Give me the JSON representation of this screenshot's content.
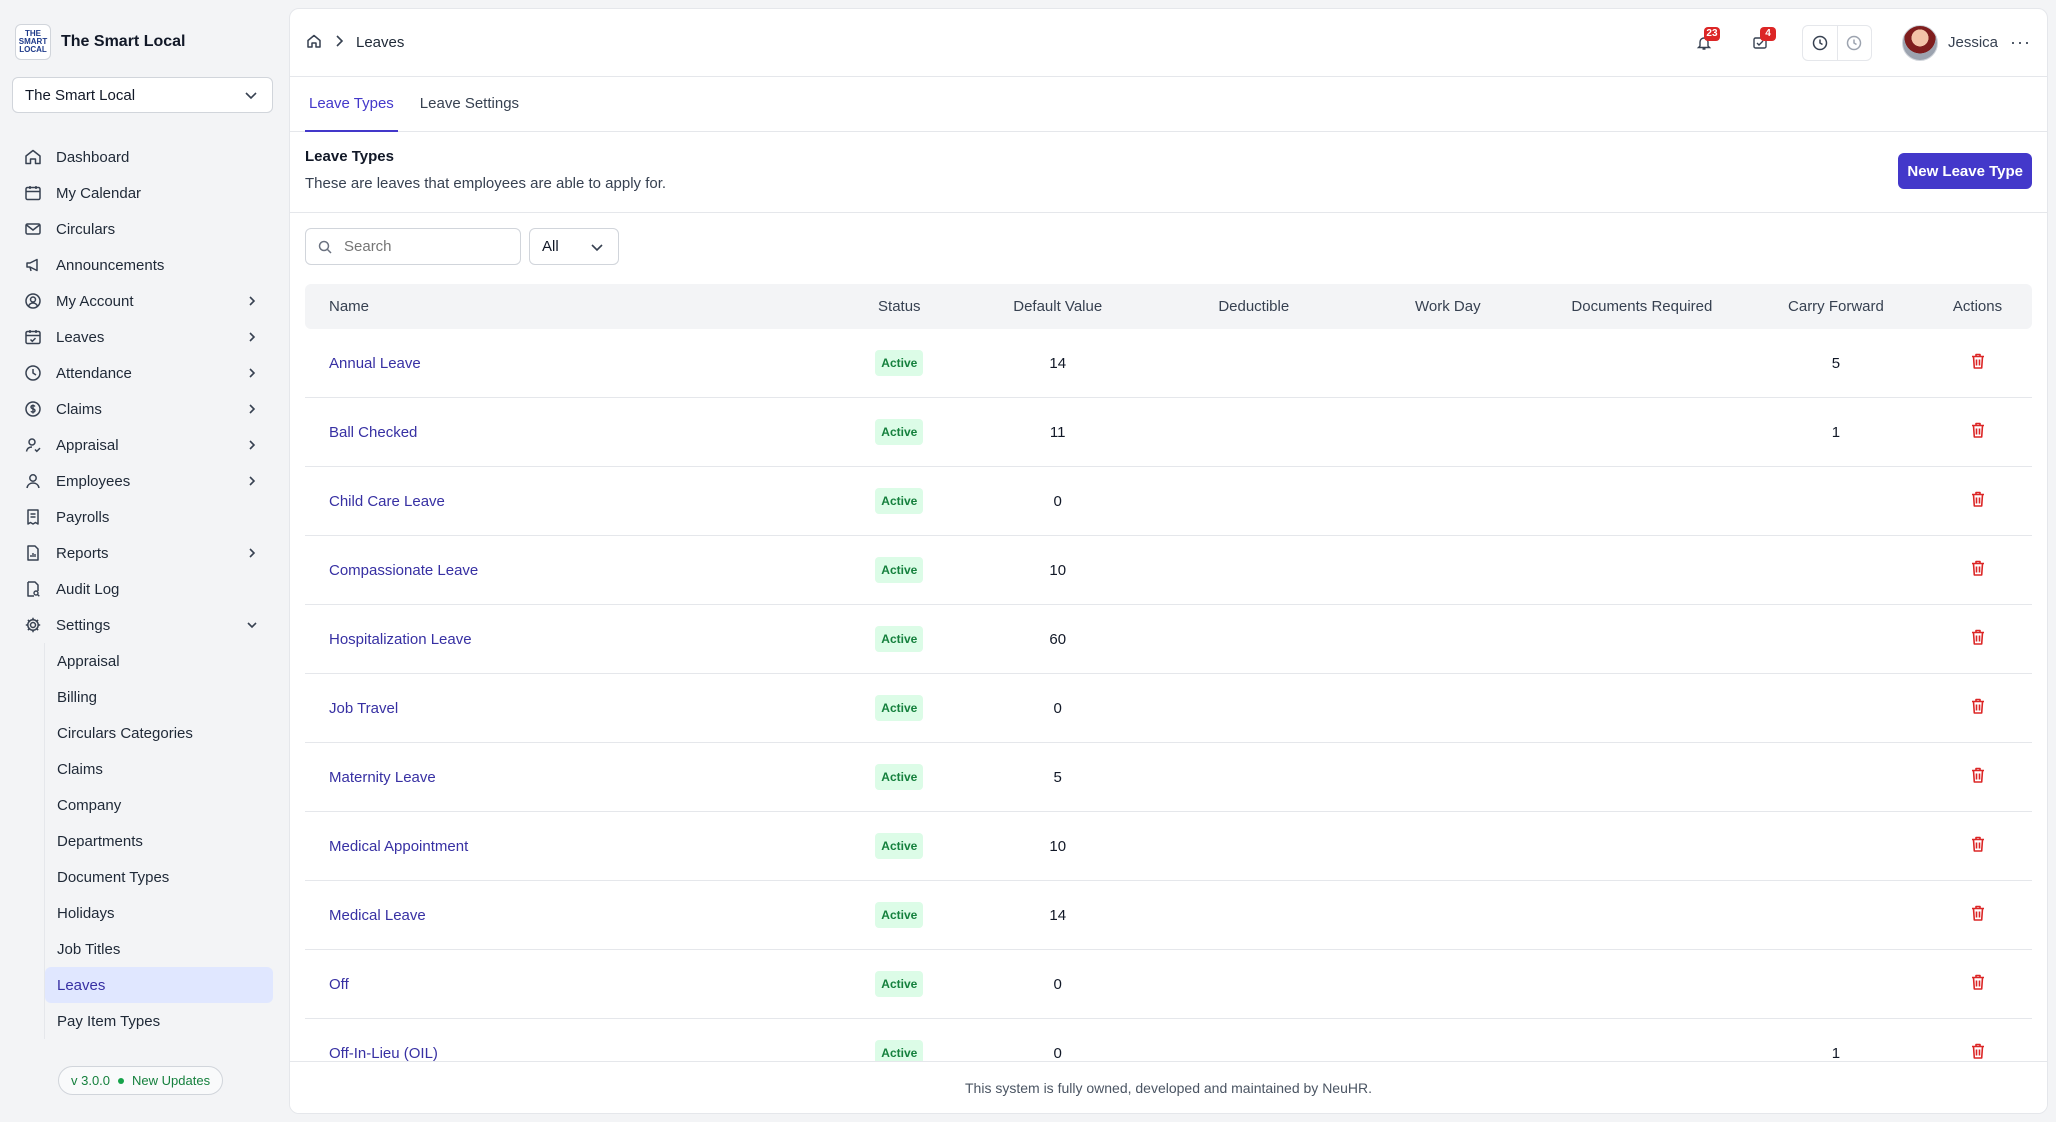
{
  "brand": {
    "logo_text": "THE SMART LOCAL",
    "name": "The Smart Local"
  },
  "org_select": {
    "value": "The Smart Local"
  },
  "nav": [
    {
      "label": "Dashboard",
      "icon": "home-icon",
      "chevron": false
    },
    {
      "label": "My Calendar",
      "icon": "calendar-icon",
      "chevron": false
    },
    {
      "label": "Circulars",
      "icon": "mail-icon",
      "chevron": false
    },
    {
      "label": "Announcements",
      "icon": "megaphone-icon",
      "chevron": false
    },
    {
      "label": "My Account",
      "icon": "user-circle-icon",
      "chevron": true
    },
    {
      "label": "Leaves",
      "icon": "calendar-check-icon",
      "chevron": true
    },
    {
      "label": "Attendance",
      "icon": "clock-icon",
      "chevron": true
    },
    {
      "label": "Claims",
      "icon": "dollar-icon",
      "chevron": true
    },
    {
      "label": "Appraisal",
      "icon": "user-check-icon",
      "chevron": true
    },
    {
      "label": "Employees",
      "icon": "user-icon",
      "chevron": true
    },
    {
      "label": "Payrolls",
      "icon": "receipt-icon",
      "chevron": false
    },
    {
      "label": "Reports",
      "icon": "file-chart-icon",
      "chevron": true
    },
    {
      "label": "Audit Log",
      "icon": "file-search-icon",
      "chevron": false
    },
    {
      "label": "Settings",
      "icon": "gear-icon",
      "chevron": "down"
    }
  ],
  "settings_sub": [
    {
      "label": "Appraisal"
    },
    {
      "label": "Billing"
    },
    {
      "label": "Circulars Categories"
    },
    {
      "label": "Claims"
    },
    {
      "label": "Company"
    },
    {
      "label": "Departments"
    },
    {
      "label": "Document Types"
    },
    {
      "label": "Holidays"
    },
    {
      "label": "Job Titles"
    },
    {
      "label": "Leaves",
      "active": true
    },
    {
      "label": "Pay Item Types"
    }
  ],
  "version": {
    "number": "v 3.0.0",
    "updates": "New Updates"
  },
  "breadcrumb": {
    "current": "Leaves"
  },
  "topbar": {
    "notifications_count": "23",
    "inbox_count": "4",
    "user_name": "Jessica"
  },
  "tabs": [
    {
      "label": "Leave Types",
      "active": true
    },
    {
      "label": "Leave Settings",
      "active": false
    }
  ],
  "section": {
    "title": "Leave Types",
    "description": "These are leaves that employees are able to apply for.",
    "new_button": "New Leave Type"
  },
  "filters": {
    "search_placeholder": "Search",
    "status_value": "All"
  },
  "table": {
    "headers": {
      "name": "Name",
      "status": "Status",
      "default": "Default Value",
      "deductible": "Deductible",
      "work_day": "Work Day",
      "documents": "Documents Required",
      "carry": "Carry Forward",
      "actions": "Actions"
    },
    "rows": [
      {
        "name": "Annual Leave",
        "status": "Active",
        "default": "14",
        "deductible": "",
        "work_day": "",
        "documents": "",
        "carry": "5"
      },
      {
        "name": "Ball Checked",
        "status": "Active",
        "default": "11",
        "deductible": "",
        "work_day": "",
        "documents": "",
        "carry": "1"
      },
      {
        "name": "Child Care Leave",
        "status": "Active",
        "default": "0",
        "deductible": "",
        "work_day": "",
        "documents": "",
        "carry": ""
      },
      {
        "name": "Compassionate Leave",
        "status": "Active",
        "default": "10",
        "deductible": "",
        "work_day": "",
        "documents": "",
        "carry": ""
      },
      {
        "name": "Hospitalization Leave",
        "status": "Active",
        "default": "60",
        "deductible": "",
        "work_day": "",
        "documents": "",
        "carry": ""
      },
      {
        "name": "Job Travel",
        "status": "Active",
        "default": "0",
        "deductible": "",
        "work_day": "",
        "documents": "",
        "carry": ""
      },
      {
        "name": "Maternity Leave",
        "status": "Active",
        "default": "5",
        "deductible": "",
        "work_day": "",
        "documents": "",
        "carry": ""
      },
      {
        "name": "Medical Appointment",
        "status": "Active",
        "default": "10",
        "deductible": "",
        "work_day": "",
        "documents": "",
        "carry": ""
      },
      {
        "name": "Medical Leave",
        "status": "Active",
        "default": "14",
        "deductible": "",
        "work_day": "",
        "documents": "",
        "carry": ""
      },
      {
        "name": "Off",
        "status": "Active",
        "default": "0",
        "deductible": "",
        "work_day": "",
        "documents": "",
        "carry": ""
      },
      {
        "name": "Off-In-Lieu (OIL)",
        "status": "Active",
        "default": "0",
        "deductible": "",
        "work_day": "",
        "documents": "",
        "carry": "1"
      }
    ]
  },
  "footer": {
    "text": "This system is fully owned, developed and maintained by NeuHR."
  },
  "colors": {
    "accent": "#4338ca",
    "active_bg": "#dcfce7",
    "active_text": "#15803d",
    "danger": "#dc2626"
  }
}
